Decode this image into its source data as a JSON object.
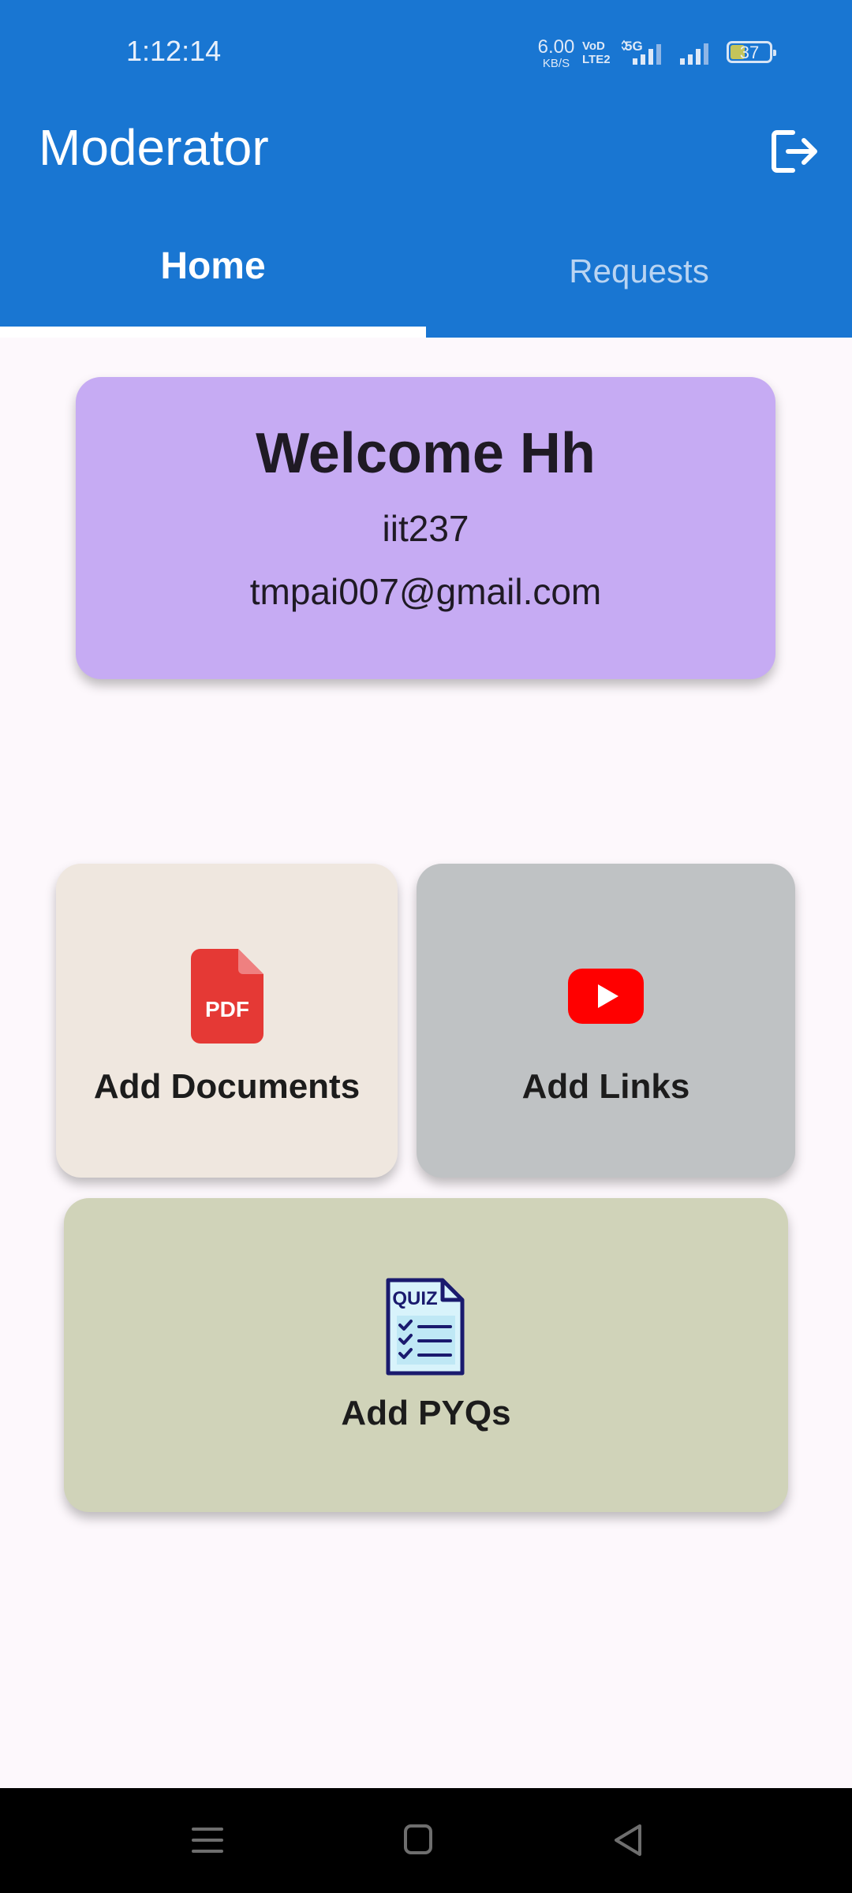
{
  "status_bar": {
    "time": "1:12:14",
    "speed_value": "6.00",
    "speed_unit": "KB/S",
    "volte_top": "VoD",
    "volte_bottom": "LTE2",
    "network": "5G",
    "battery": "37",
    "battery_fraction": 0.37
  },
  "app_bar": {
    "title": "Moderator",
    "logout_icon": "logout-icon"
  },
  "tabs": [
    {
      "label": "Home",
      "selected": true
    },
    {
      "label": "Requests",
      "selected": false
    }
  ],
  "welcome": {
    "title": "Welcome Hh",
    "user_id": "iit237",
    "email": "tmpai007@gmail.com"
  },
  "actions": {
    "documents": {
      "label": "Add Documents",
      "icon": "pdf-icon",
      "icon_text": "PDF"
    },
    "links": {
      "label": "Add Links",
      "icon": "youtube-icon"
    },
    "pyqs": {
      "label": "Add PYQs",
      "icon": "quiz-icon",
      "icon_text": "QUIZ"
    }
  },
  "colors": {
    "app_bar": "#1976d2",
    "welcome_card": "#c6abf3",
    "documents_card": "#efe7df",
    "links_card": "#bfc2c4",
    "pyqs_card": "#d0d3b9"
  },
  "nav": {
    "menu": "menu-icon",
    "home": "home-icon",
    "back": "back-icon"
  }
}
